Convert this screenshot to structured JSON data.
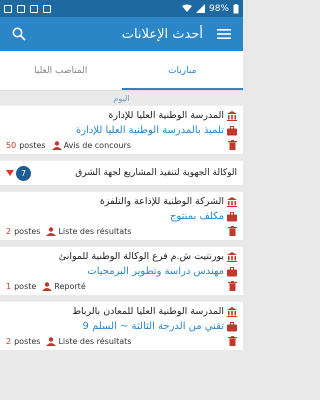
{
  "statusbar": {
    "battery": "98%"
  },
  "appbar": {
    "title": "أحدث الإعلانات"
  },
  "tabs": [
    {
      "label": "مباريات",
      "active": true
    },
    {
      "label": "المناصب العليا",
      "active": false
    }
  ],
  "section": {
    "label": "اليوم"
  },
  "items": [
    {
      "org": "المدرسة الوطنية العليا للإدارة",
      "position": "تلميذ بالمدرسة الوطنية العليا للإدارة",
      "count": "50",
      "unit": "postes",
      "status": "Avis de concours"
    },
    {
      "group": true,
      "title": "الوكالة الجهوية لتنفيذ المشاريع لجهة الشرق",
      "badge": "7"
    },
    {
      "org": "الشركة الوطنية للإذاعة والتلفزة",
      "position": "مكلف بمنتوج",
      "count": "2",
      "unit": "postes",
      "status": "Liste des résultats"
    },
    {
      "org": "بورنتيت ش.م فرع الوكالة الوطنية للموانئ",
      "position": "مهندس دراسة وتطوير البرمجيات",
      "count": "1",
      "unit": "poste",
      "status": "Reporté"
    },
    {
      "org": "المدرسة الوطنية العليا للمعادن بالرباط",
      "position": "تقني من الدرجة الثالثة ~ السلم 9",
      "count": "2",
      "unit": "postes",
      "status": "Liste des résultats"
    }
  ]
}
